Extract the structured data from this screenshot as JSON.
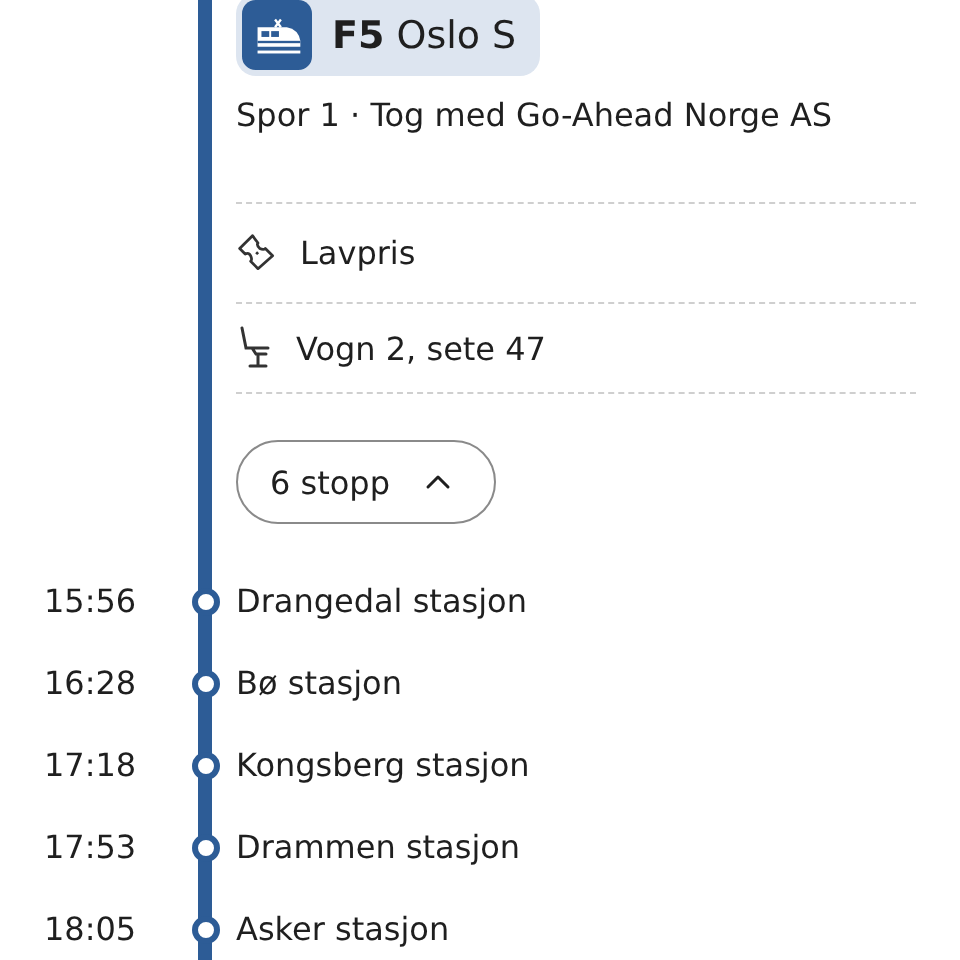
{
  "trip": {
    "line": "**F5** Oslo S",
    "platform_info": "Spor 1 · Tog med Go-Ahead Norge AS"
  },
  "details": [
    {
      "kind": "ticket",
      "text": "Lavpris"
    },
    {
      "kind": "seat",
      "text": "Vogn 2, sete 47"
    }
  ],
  "stops_toggle": {
    "label": "6 stopp",
    "expanded": true
  },
  "stops": [
    {
      "time": "15:56",
      "name": "Drangedal stasjon"
    },
    {
      "time": "16:28",
      "name": "Bø stasjon"
    },
    {
      "time": "17:18",
      "name": "Kongsberg stasjon"
    },
    {
      "time": "17:53",
      "name": "Drammen stasjon"
    },
    {
      "time": "18:05",
      "name": "Asker stasjon"
    }
  ]
}
